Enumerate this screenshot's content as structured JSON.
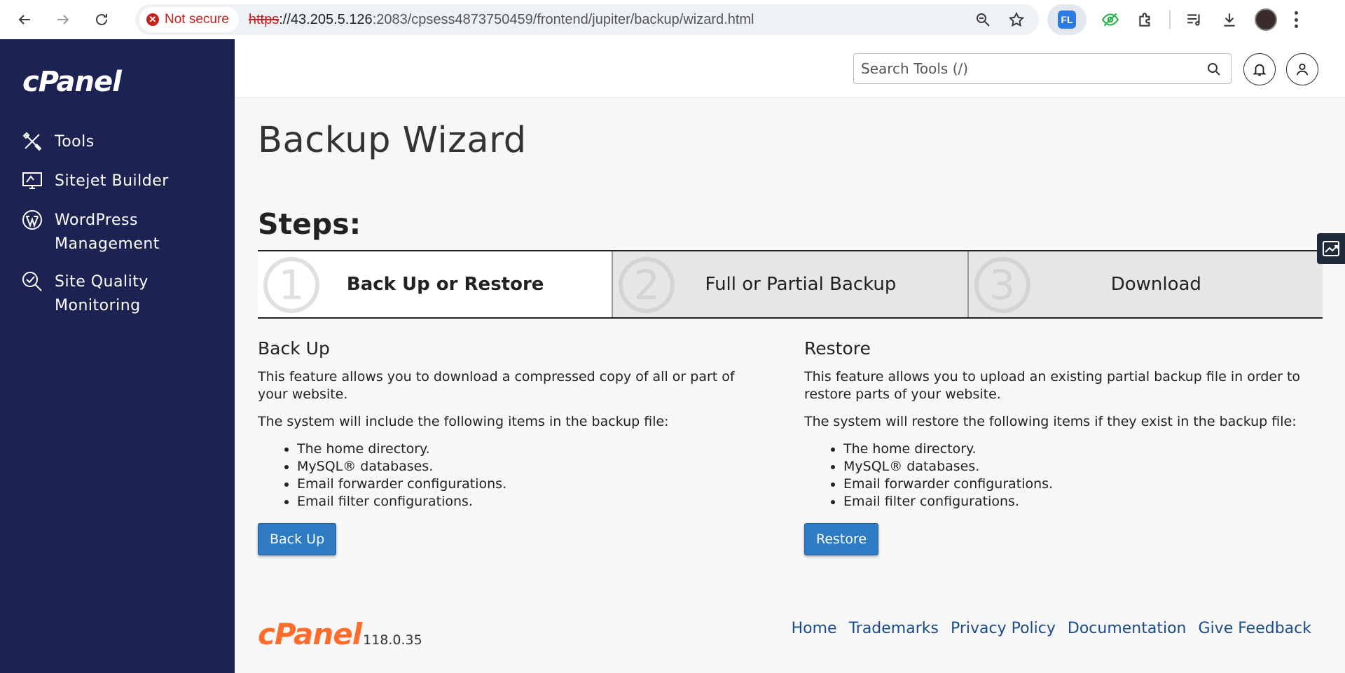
{
  "browser": {
    "security_label": "Not secure",
    "url_scheme": "https",
    "url_host": "://43.205.5.126",
    "url_path": ":2083/cpsess4873750459/frontend/jupiter/backup/wizard.html",
    "extension_label": "FL"
  },
  "sidebar": {
    "logo": "cPanel",
    "items": [
      {
        "label": "Tools",
        "icon": "tools-icon"
      },
      {
        "label": "Sitejet Builder",
        "icon": "sitejet-icon"
      },
      {
        "label": "WordPress Management",
        "icon": "wordpress-icon"
      },
      {
        "label": "Site Quality Monitoring",
        "icon": "site-quality-icon"
      }
    ]
  },
  "topbar": {
    "search_placeholder": "Search Tools (/)"
  },
  "page": {
    "title": "Backup Wizard",
    "steps_heading": "Steps:",
    "steps": [
      {
        "number": "1",
        "label": "Back Up or Restore",
        "active": true
      },
      {
        "number": "2",
        "label": "Full or Partial Backup",
        "active": false
      },
      {
        "number": "3",
        "label": "Download",
        "active": false
      }
    ],
    "backup": {
      "heading": "Back Up",
      "description": "This feature allows you to download a compressed copy of all or part of your website.",
      "includes_intro": "The system will include the following items in the backup file:",
      "items": [
        "The home directory.",
        "MySQL® databases.",
        "Email forwarder configurations.",
        "Email filter configurations."
      ],
      "button_label": "Back Up"
    },
    "restore": {
      "heading": "Restore",
      "description": "This feature allows you to upload an existing partial backup file in order to restore parts of your website.",
      "includes_intro": "The system will restore the following items if they exist in the backup file:",
      "items": [
        "The home directory.",
        "MySQL® databases.",
        "Email forwarder configurations.",
        "Email filter configurations."
      ],
      "button_label": "Restore"
    }
  },
  "footer": {
    "logo": "cPanel",
    "version": "118.0.35",
    "links": [
      "Home",
      "Trademarks",
      "Privacy Policy",
      "Documentation",
      "Give Feedback"
    ]
  },
  "colors": {
    "sidebar_bg": "#1c2252",
    "button_blue": "#2e7bc4",
    "footer_logo": "#ff6c2c",
    "link": "#1a4c8a",
    "insecure_red": "#c5221f"
  }
}
